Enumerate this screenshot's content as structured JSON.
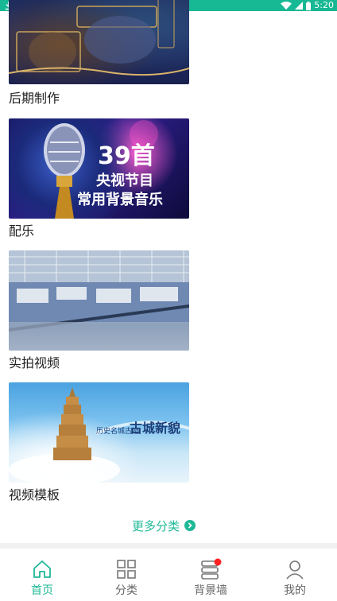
{
  "status": {
    "time": "5:20"
  },
  "cards": [
    {
      "label": "后期制作"
    },
    {
      "label": "配乐",
      "title_num": "39首",
      "line1": "央视节目",
      "line2": "常用背景音乐"
    },
    {
      "label": "实拍视频"
    },
    {
      "label": "视频模板",
      "overlay_small": "历史名城古迹",
      "overlay_big": "古城新貌"
    }
  ],
  "more": {
    "label": "更多分类"
  },
  "tabs": [
    {
      "label": "首页"
    },
    {
      "label": "分类"
    },
    {
      "label": "背景墙"
    },
    {
      "label": "我的"
    }
  ],
  "colors": {
    "accent": "#1fb897",
    "status_bar": "#17b894",
    "badge": "#ff2222"
  }
}
